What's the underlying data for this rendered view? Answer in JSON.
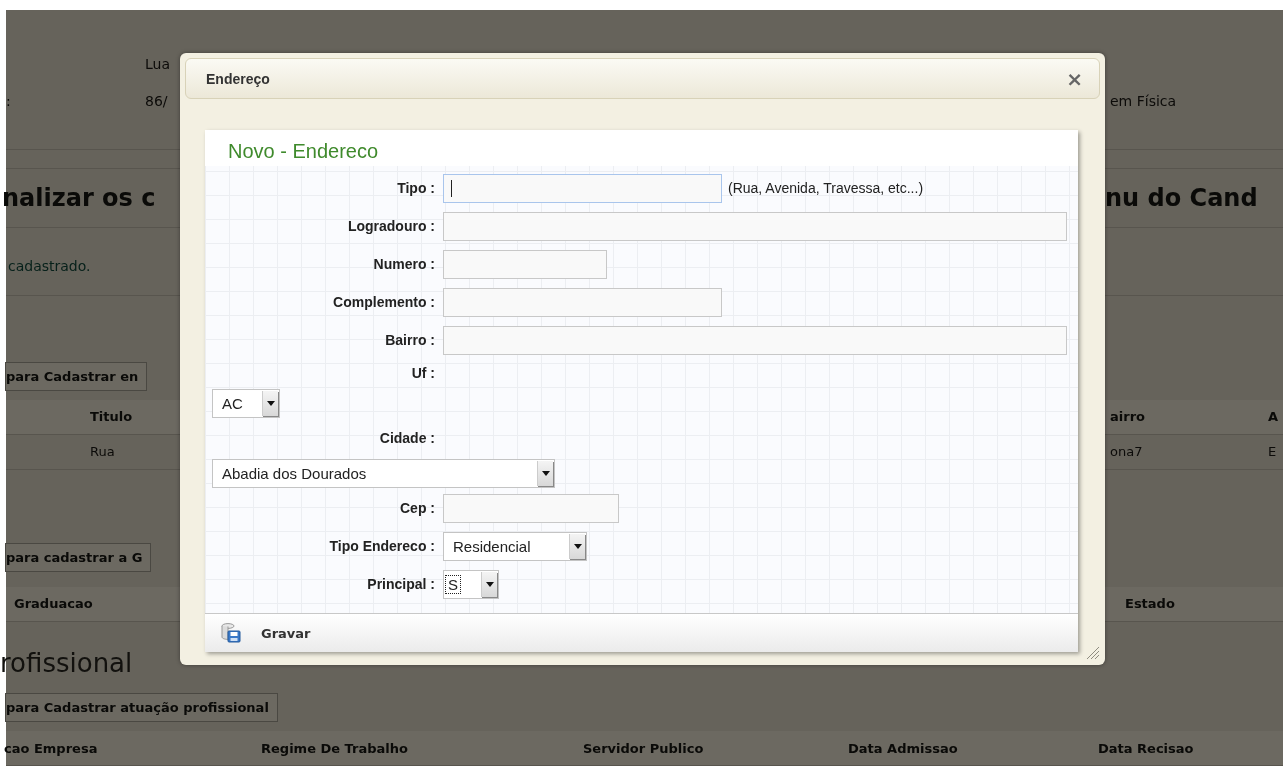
{
  "background_page": {
    "info_rows": [
      {
        "left": "",
        "middle": "Lua",
        "right": ""
      },
      {
        "left": ":",
        "middle": "86/",
        "right": "em Física"
      }
    ],
    "heading": {
      "left": "nalizar os c",
      "right": "nu do Cand"
    },
    "message": "cadastrado.",
    "address_button": "para Cadastrar en",
    "address_table": {
      "columns": [
        "Titulo",
        "airro",
        "A"
      ],
      "rows": [
        [
          "Rua",
          "ona7",
          "E"
        ]
      ]
    },
    "graduation_button": "para cadastrar a G",
    "graduation_table": {
      "columns": [
        "Graduacao",
        "Estado"
      ]
    },
    "section_heading": "rofissional",
    "work_button": "para Cadastrar atuação profissional",
    "work_table": {
      "columns": [
        "cao Empresa",
        "Regime De Trabalho",
        "Servidor Publico",
        "Data Admissao",
        "Data Recisao"
      ]
    }
  },
  "dialog": {
    "title": "Endereço",
    "close": "×",
    "heading": "Novo - Endereco",
    "fields": [
      {
        "label": "Tipo :",
        "kind": "text",
        "focused": true,
        "hint": "(Rua, Avenida, Travessa, etc...)"
      },
      {
        "label": "Logradouro :",
        "kind": "text",
        "focused": false
      },
      {
        "label": "Numero :",
        "kind": "text",
        "focused": false
      },
      {
        "label": "Complemento :",
        "kind": "text",
        "focused": false
      },
      {
        "label": "Bairro :",
        "kind": "text",
        "focused": false
      },
      {
        "label": "Uf :",
        "kind": "select-below",
        "value": "AC",
        "focused": false
      },
      {
        "label": "Cidade :",
        "kind": "select-below",
        "value": "Abadia dos Dourados",
        "focused": false
      },
      {
        "label": "Cep :",
        "kind": "text",
        "focused": false
      },
      {
        "label": "Tipo Endereco :",
        "kind": "select",
        "value": "Residencial",
        "focused": false
      },
      {
        "label": "Principal :",
        "kind": "select",
        "value": "S",
        "focused": true
      }
    ],
    "save_button": "Gravar"
  }
}
